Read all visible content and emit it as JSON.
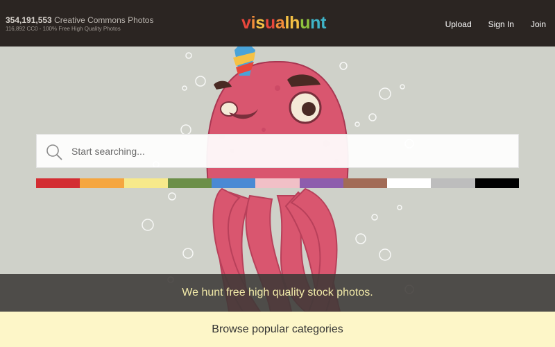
{
  "header": {
    "photo_count": "354,191,553",
    "photo_label": "Creative Commons Photos",
    "cc0_line": "116,892 CC0 - 100% Free High Quality Photos",
    "logo_letters": [
      {
        "ch": "v",
        "color": "#e8473c"
      },
      {
        "ch": "i",
        "color": "#f28c3a"
      },
      {
        "ch": "s",
        "color": "#f5c145"
      },
      {
        "ch": "u",
        "color": "#e8473c"
      },
      {
        "ch": "a",
        "color": "#f28c3a"
      },
      {
        "ch": "l",
        "color": "#f5c145"
      },
      {
        "ch": "h",
        "color": "#f5c145"
      },
      {
        "ch": "u",
        "color": "#8fc43e"
      },
      {
        "ch": "n",
        "color": "#3fb4c8"
      },
      {
        "ch": "t",
        "color": "#3fb4c8"
      }
    ],
    "nav": {
      "upload": "Upload",
      "signin": "Sign In",
      "join": "Join"
    }
  },
  "search": {
    "placeholder": "Start searching...",
    "icon": "search-icon"
  },
  "color_filters": [
    {
      "name": "red",
      "color": "#d32d32"
    },
    {
      "name": "orange",
      "color": "#f5a640"
    },
    {
      "name": "yellow",
      "color": "#f7e98b"
    },
    {
      "name": "green",
      "color": "#6c8f48"
    },
    {
      "name": "blue",
      "color": "#4a8ad4"
    },
    {
      "name": "pink",
      "color": "#f1c0c7"
    },
    {
      "name": "purple",
      "color": "#8d5dad"
    },
    {
      "name": "brown",
      "color": "#a26b56"
    },
    {
      "name": "white",
      "color": "#ffffff"
    },
    {
      "name": "gray",
      "color": "#bdbdbd"
    },
    {
      "name": "black",
      "color": "#000000"
    }
  ],
  "tagline": "We hunt free high quality stock photos.",
  "browse_label": "Browse popular categories"
}
